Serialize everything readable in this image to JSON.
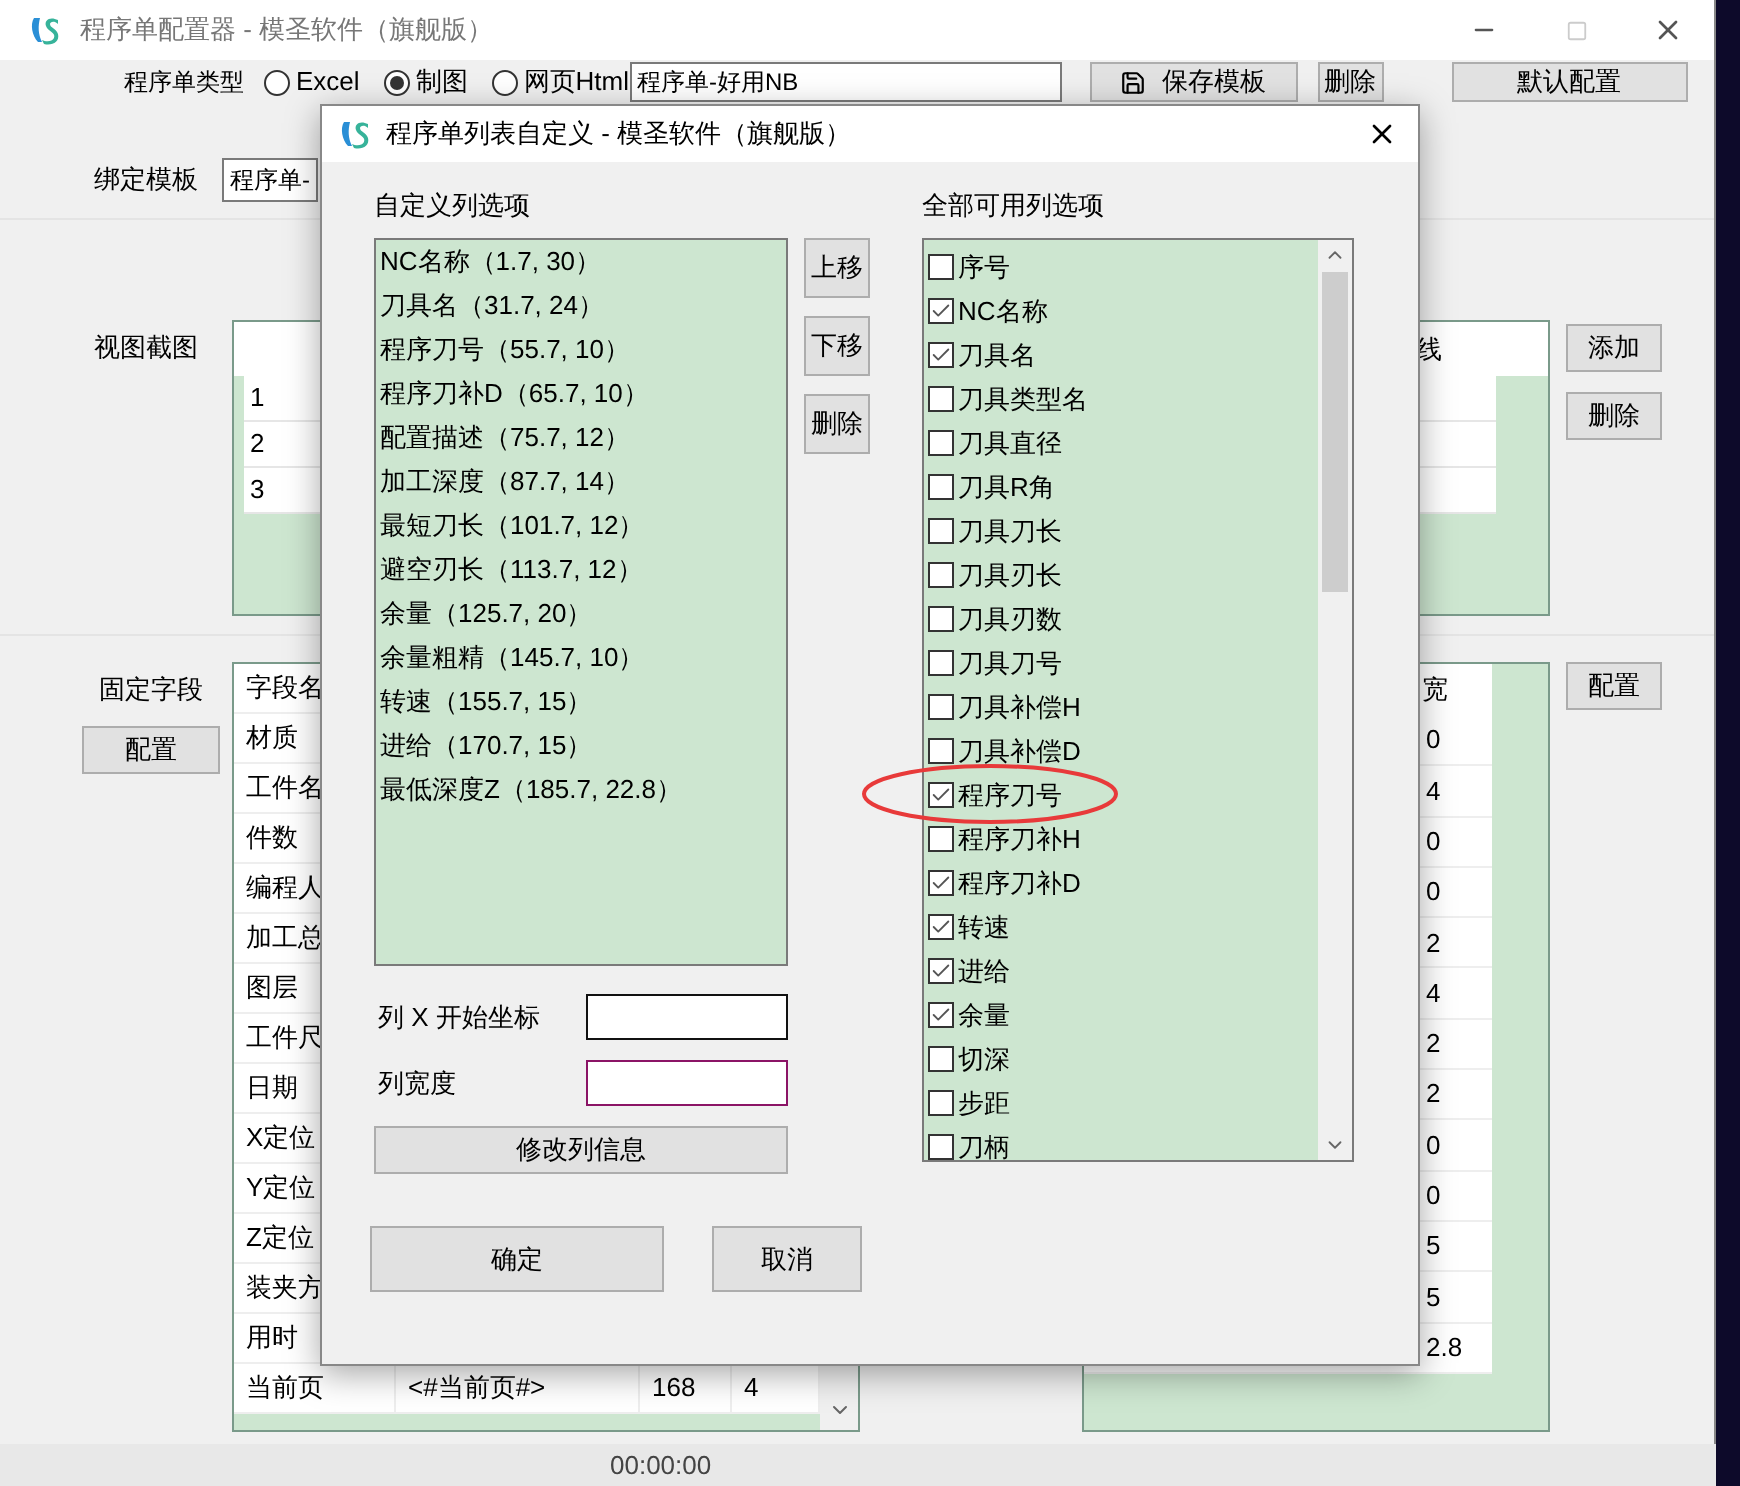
{
  "window": {
    "title": "程序单配置器 - 模圣软件（旗舰版）"
  },
  "type_row": {
    "label": "程序单类型",
    "options": [
      {
        "label": "Excel",
        "selected": false
      },
      {
        "label": "制图",
        "selected": true
      },
      {
        "label": "网页Html",
        "selected": false
      }
    ],
    "template_select": {
      "value": "程序单-好用NB"
    },
    "buttons": [
      {
        "kind": "save",
        "label": "保存模板"
      },
      {
        "kind": "plain",
        "label": "删除"
      }
    ],
    "default_button": "默认配置"
  },
  "bind_row": {
    "label": "绑定模板",
    "value": "程序单-"
  },
  "view_section": {
    "label": "视图截图",
    "header": "线",
    "rows": [
      "1",
      "2",
      "3"
    ],
    "buttons": [
      "添加",
      "删除"
    ]
  },
  "fixed_section": {
    "label": "固定字段",
    "config_button": "配置",
    "rows": [
      {
        "cells": [
          "字段名"
        ]
      },
      {
        "cells": [
          "材质"
        ]
      },
      {
        "cells": [
          "工件名"
        ]
      },
      {
        "cells": [
          "件数"
        ]
      },
      {
        "cells": [
          "编程人"
        ]
      },
      {
        "cells": [
          "加工总"
        ]
      },
      {
        "cells": [
          "图层"
        ]
      },
      {
        "cells": [
          "工件尺"
        ]
      },
      {
        "cells": [
          "日期"
        ]
      },
      {
        "cells": [
          "X定位"
        ]
      },
      {
        "cells": [
          "Y定位"
        ]
      },
      {
        "cells": [
          "Z定位"
        ]
      },
      {
        "cells": [
          "装夹方"
        ]
      },
      {
        "cells": [
          "用时"
        ]
      },
      {
        "cells": [
          "当前页",
          "<#当前页#>",
          "168",
          "4"
        ]
      }
    ],
    "width_header": "宽",
    "widths": [
      "0",
      "4",
      "0",
      "0",
      "2",
      "4",
      "2",
      "2",
      "0",
      "0",
      "5",
      "5",
      "2.8"
    ],
    "right_button": "配置"
  },
  "dialog": {
    "title": "程序单列表自定义 - 模圣软件（旗舰版）",
    "left_title": "自定义列选项",
    "columns": [
      "NC名称（1.7, 30）",
      "刀具名（31.7, 24）",
      "程序刀号（55.7, 10）",
      "程序刀补D（65.7, 10）",
      "配置描述（75.7, 12）",
      "加工深度（87.7, 14）",
      "最短刀长（101.7, 12）",
      "避空刃长（113.7, 12）",
      "余量（125.7, 20）",
      "余量粗精（145.7, 10）",
      "转速（155.7, 15）",
      "进给（170.7, 15）",
      "最低深度Z（185.7, 22.8）"
    ],
    "move_buttons": [
      "上移",
      "下移",
      "删除"
    ],
    "fields": [
      {
        "label": "列 X 开始坐标",
        "focused": false
      },
      {
        "label": "列宽度",
        "focused": true
      }
    ],
    "modify_button": "修改列信息",
    "ok_button": "确定",
    "cancel_button": "取消",
    "right_title": "全部可用列选项",
    "options": [
      {
        "label": "序号",
        "checked": false,
        "circled": false
      },
      {
        "label": "NC名称",
        "checked": true,
        "circled": false
      },
      {
        "label": "刀具名",
        "checked": true,
        "circled": false
      },
      {
        "label": "刀具类型名",
        "checked": false,
        "circled": false
      },
      {
        "label": "刀具直径",
        "checked": false,
        "circled": false
      },
      {
        "label": "刀具R角",
        "checked": false,
        "circled": false
      },
      {
        "label": "刀具刀长",
        "checked": false,
        "circled": false
      },
      {
        "label": "刀具刃长",
        "checked": false,
        "circled": false
      },
      {
        "label": "刀具刃数",
        "checked": false,
        "circled": false
      },
      {
        "label": "刀具刀号",
        "checked": false,
        "circled": false
      },
      {
        "label": "刀具补偿H",
        "checked": false,
        "circled": false
      },
      {
        "label": "刀具补偿D",
        "checked": false,
        "circled": false
      },
      {
        "label": "程序刀号",
        "checked": true,
        "circled": true
      },
      {
        "label": "程序刀补H",
        "checked": false,
        "circled": false
      },
      {
        "label": "程序刀补D",
        "checked": true,
        "circled": false
      },
      {
        "label": "转速",
        "checked": true,
        "circled": false
      },
      {
        "label": "进给",
        "checked": true,
        "circled": false
      },
      {
        "label": "余量",
        "checked": true,
        "circled": false
      },
      {
        "label": "切深",
        "checked": false,
        "circled": false
      },
      {
        "label": "步距",
        "checked": false,
        "circled": false
      },
      {
        "label": "刀柄",
        "checked": false,
        "circled": false
      }
    ]
  },
  "taskbar": {
    "time": "00:00:00"
  }
}
